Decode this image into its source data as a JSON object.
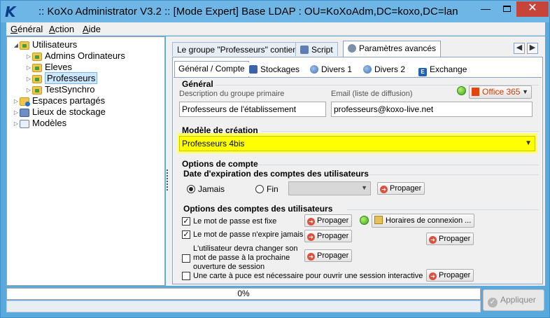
{
  "window": {
    "title": ":: KoXo Administrator V3.2 :: [Mode Expert] Base LDAP : OU=KoXoAdm,DC=koxo,DC=lan",
    "logo": "K"
  },
  "menu": {
    "items": [
      "Général",
      "Action",
      "Aide"
    ]
  },
  "tree": {
    "root": "Utilisateurs",
    "children": [
      "Admins Ordinateurs",
      "Eleves",
      "Professeurs",
      "TestSynchro"
    ],
    "others": [
      "Espaces partagés",
      "Lieux de stockage",
      "Modèles"
    ]
  },
  "tabs_top": [
    "Le groupe \"Professeurs\" contient",
    "Script",
    "Paramètres avancés"
  ],
  "tabs_sub": [
    "Général / Compte",
    "Stockages",
    "Divers 1",
    "Divers 2",
    "Exchange"
  ],
  "general": {
    "title": "Général",
    "description_label": "Description du groupe primaire",
    "description_value": "Professeurs de l'établissement",
    "email_label": "Email (liste de diffusion)",
    "email_value": "professeurs@koxo-live.net",
    "office_button": "Office 365"
  },
  "model": {
    "title": "Modèle de création",
    "value": "Professeurs 4bis"
  },
  "account_options": {
    "title": "Options de compte",
    "expiration_title": "Date d'expiration des comptes des utilisateurs",
    "never_label": "Jamais",
    "end_label": "Fin",
    "propagate": "Propager"
  },
  "user_options": {
    "title": "Options des comptes des utilisateurs",
    "pwd_fixed": "Le mot de passe est fixe",
    "pwd_never_expires": "Le mot de passe n'expire jamais",
    "must_change_line1": "L'utilisateur devra changer son",
    "must_change_line2": "mot de passe à la prochaine",
    "must_change_line3": "ouverture de session",
    "smartcard": "Une carte à puce est nécessaire pour ouvrir une session interactive",
    "hours_button": "Horaires de connexion ...",
    "propagate": "Propager"
  },
  "footer": {
    "progress": "0%",
    "progress_value": 0,
    "apply": "Appliquer"
  }
}
